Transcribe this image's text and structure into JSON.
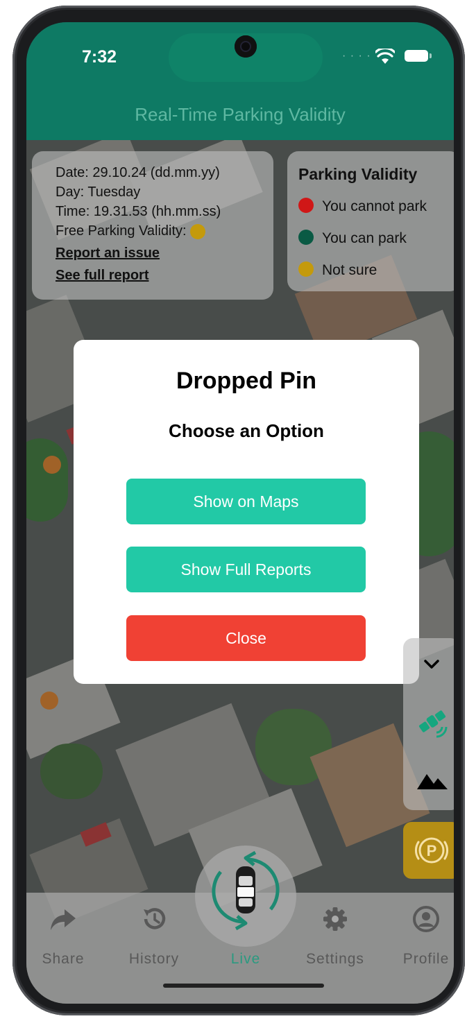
{
  "status_bar": {
    "time": "7:32"
  },
  "header": {
    "title": "Real-Time Parking Validity"
  },
  "info_card": {
    "date": "Date: 29.10.24 (dd.mm.yy)",
    "day": "Day: Tuesday",
    "time": "Time: 19.31.53 (hh.mm.ss)",
    "validity_label": "Free Parking Validity:",
    "validity_color": "#c49a0c",
    "report_issue": "Report an issue",
    "see_report": "See full report"
  },
  "legend": {
    "title": "Parking Validity",
    "items": [
      {
        "label": "You cannot park",
        "color": "#d01717"
      },
      {
        "label": "You can park",
        "color": "#0a5a44"
      },
      {
        "label": "Not sure",
        "color": "#c49a0c"
      }
    ]
  },
  "modal": {
    "title": "Dropped Pin",
    "subtitle": "Choose an Option",
    "buttons": [
      {
        "label": "Show on Maps",
        "color": "#22c9a6"
      },
      {
        "label": "Show Full Reports",
        "color": "#22c9a6"
      },
      {
        "label": "Close",
        "color": "#f04134"
      }
    ]
  },
  "map_controls": [
    "chevron-down-icon",
    "satellite-icon",
    "terrain-icon",
    "parking-icon"
  ],
  "tabs": [
    {
      "label": "Share",
      "icon": "share-icon",
      "color": "#585858"
    },
    {
      "label": "History",
      "icon": "history-icon",
      "color": "#585858"
    },
    {
      "label": "Live",
      "icon": "live-car-icon",
      "color": "#2a9a80"
    },
    {
      "label": "Settings",
      "icon": "gear-icon",
      "color": "#585858"
    },
    {
      "label": "Profile",
      "icon": "profile-icon",
      "color": "#585858"
    }
  ],
  "colors": {
    "header": "#0e7a64",
    "accent": "#22c9a6",
    "danger": "#f04134",
    "parking": "#b58e15"
  }
}
